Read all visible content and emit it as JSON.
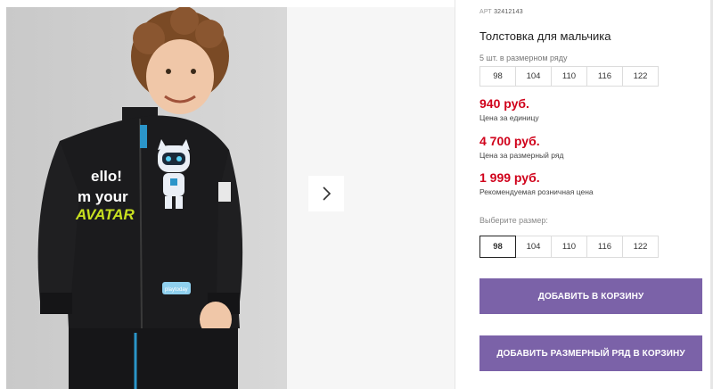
{
  "product": {
    "sku_label": "АРТ",
    "sku_value": "32412143",
    "title": "Толстовка для мальчика",
    "sizes_note": "5 шт. в размерном ряду",
    "size_range": [
      "98",
      "104",
      "110",
      "116",
      "122"
    ],
    "prices": [
      {
        "value": "940 руб.",
        "label": "Цена за единицу"
      },
      {
        "value": "4 700 руб.",
        "label": "Цена за размерный ряд"
      },
      {
        "value": "1 999 руб.",
        "label": "Рекомендуемая розничная цена"
      }
    ],
    "choose_size_label": "Выберите размер:",
    "selectable_sizes": [
      "98",
      "104",
      "110",
      "116",
      "122"
    ],
    "selected_size": "98",
    "add_to_cart": "ДОБАВИТЬ В КОРЗИНУ",
    "add_range_to_cart": "ДОБАВИТЬ РАЗМЕРНЫЙ РЯД В КОРЗИНУ"
  },
  "gallery": {
    "print_text_1": "ello!",
    "print_text_2": "m your",
    "print_text_3": "AVATAR",
    "patch_text": "playtoday",
    "next_icon": "chevron-right-icon"
  },
  "colors": {
    "price_red": "#d0021b",
    "button_purple": "#7b62a8"
  }
}
